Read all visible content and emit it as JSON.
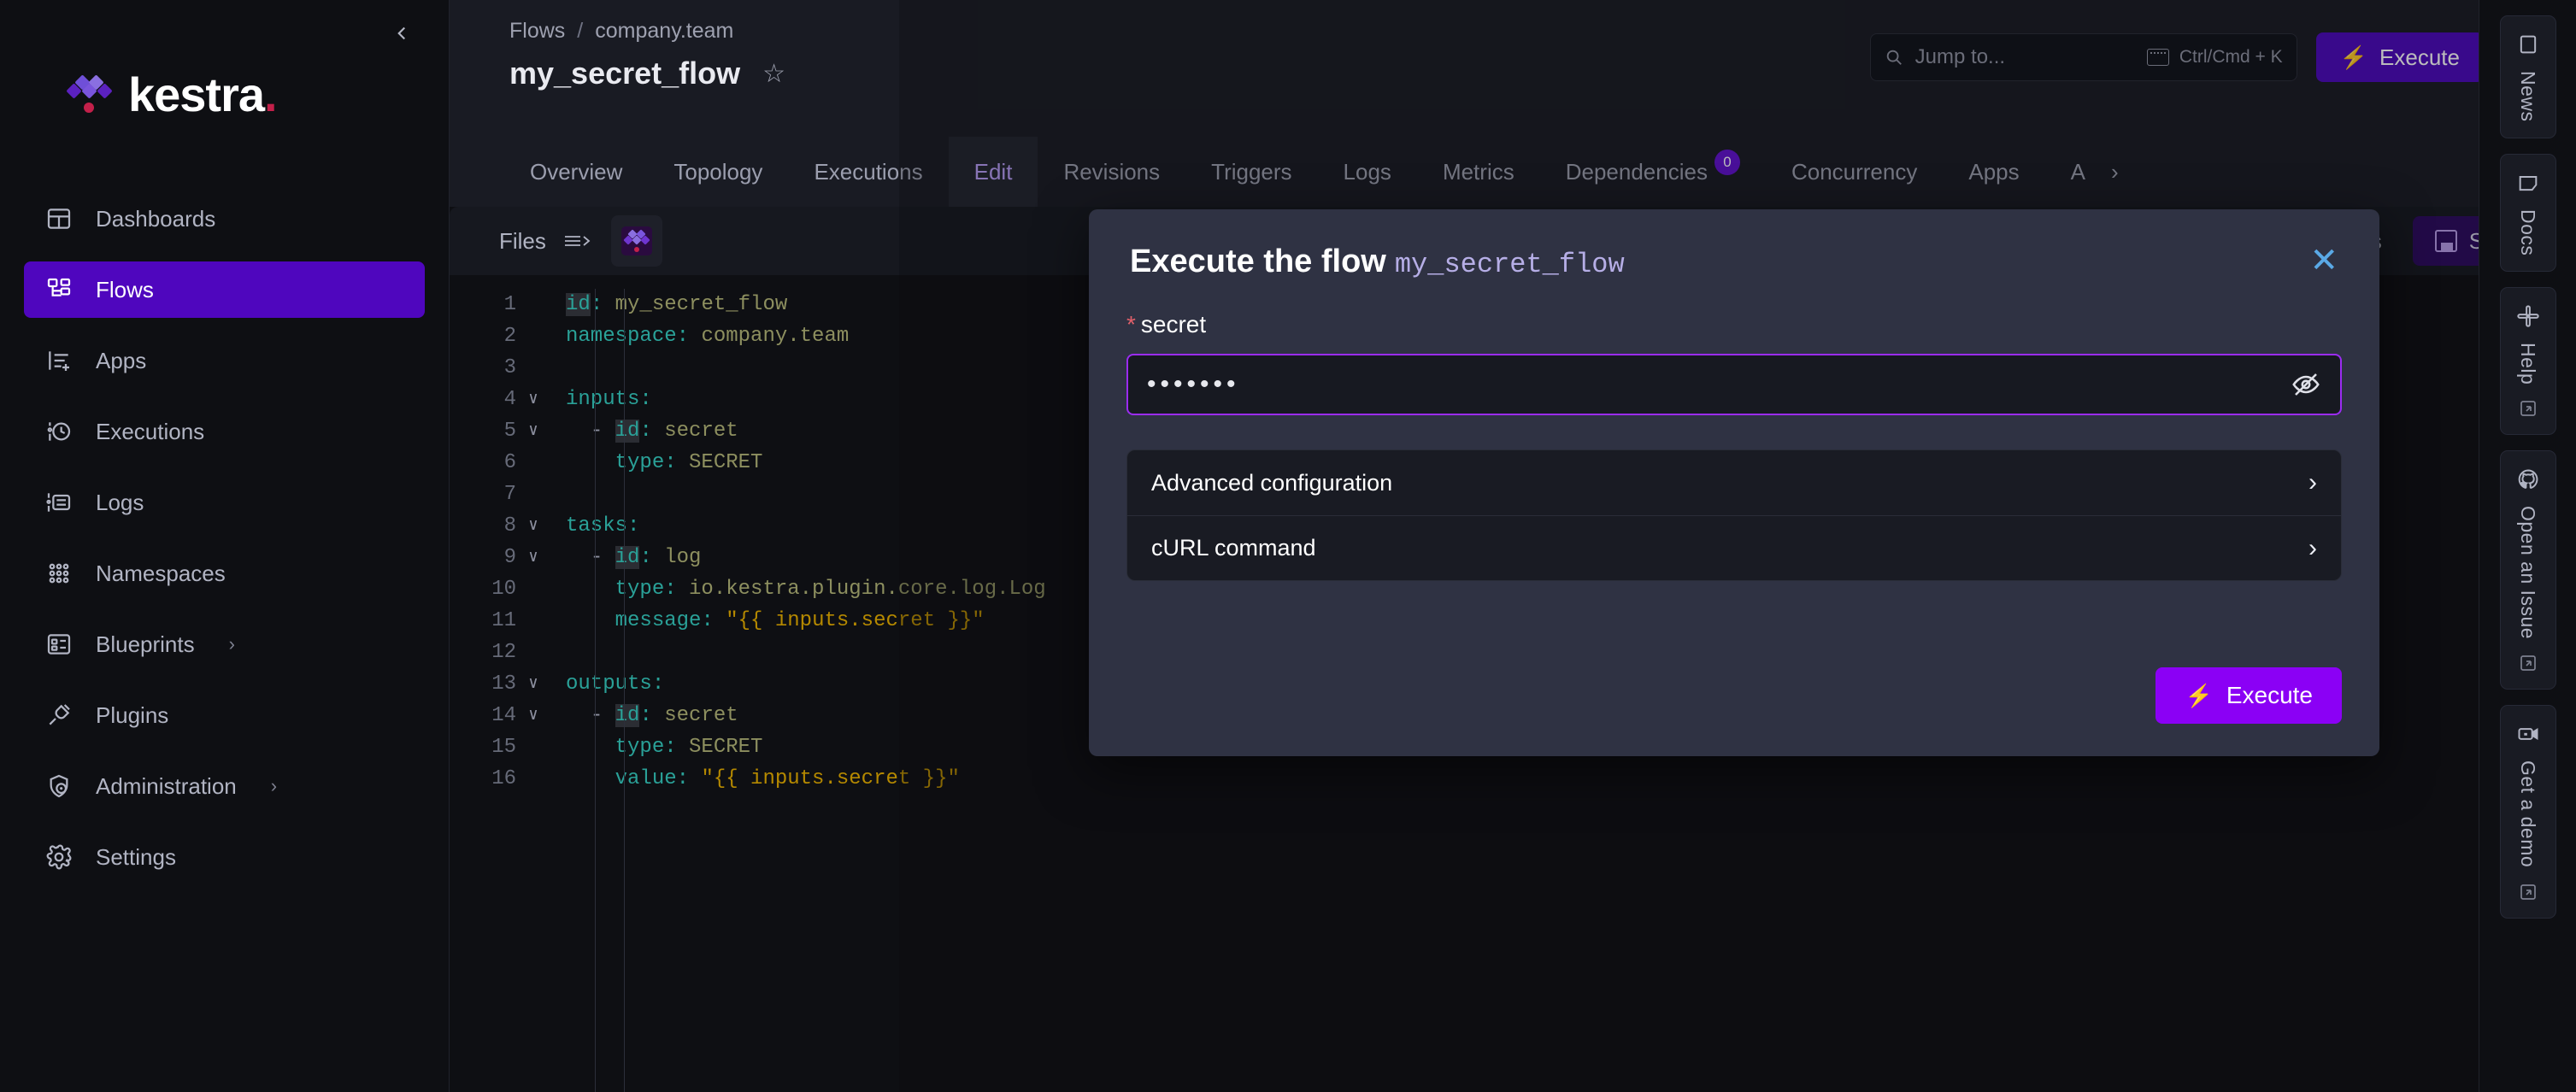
{
  "sidebar": {
    "logo_text": "kestra",
    "logo_dot": ".",
    "collapse_icon": "chevron-left",
    "items": [
      {
        "label": "Dashboards",
        "icon": "dashboard-icon",
        "active": false,
        "chevron": ""
      },
      {
        "label": "Flows",
        "icon": "flows-icon",
        "active": true,
        "chevron": ""
      },
      {
        "label": "Apps",
        "icon": "apps-icon",
        "active": false,
        "chevron": ""
      },
      {
        "label": "Executions",
        "icon": "executions-icon",
        "active": false,
        "chevron": ""
      },
      {
        "label": "Logs",
        "icon": "logs-icon",
        "active": false,
        "chevron": ""
      },
      {
        "label": "Namespaces",
        "icon": "namespaces-icon",
        "active": false,
        "chevron": ""
      },
      {
        "label": "Blueprints",
        "icon": "blueprints-icon",
        "active": false,
        "chevron": "›"
      },
      {
        "label": "Plugins",
        "icon": "plugins-icon",
        "active": false,
        "chevron": ""
      },
      {
        "label": "Administration",
        "icon": "administration-icon",
        "active": false,
        "chevron": "›"
      },
      {
        "label": "Settings",
        "icon": "settings-icon",
        "active": false,
        "chevron": ""
      }
    ]
  },
  "header": {
    "breadcrumb_root": "Flows",
    "breadcrumb_sep": "/",
    "breadcrumb_namespace": "company.team",
    "page_title": "my_secret_flow",
    "star_glyph": "☆",
    "jump_placeholder": "Jump to...",
    "shortcut_hint": "Ctrl/Cmd + K",
    "execute_label": "Execute",
    "execute_bolt": "⚡"
  },
  "tabs": [
    {
      "label": "Overview",
      "active": false,
      "badge": ""
    },
    {
      "label": "Topology",
      "active": false,
      "badge": ""
    },
    {
      "label": "Executions",
      "active": false,
      "badge": ""
    },
    {
      "label": "Edit",
      "active": true,
      "badge": ""
    },
    {
      "label": "Revisions",
      "active": false,
      "badge": ""
    },
    {
      "label": "Triggers",
      "active": false,
      "badge": ""
    },
    {
      "label": "Logs",
      "active": false,
      "badge": ""
    },
    {
      "label": "Metrics",
      "active": false,
      "badge": ""
    },
    {
      "label": "Dependencies",
      "active": false,
      "badge": "0"
    },
    {
      "label": "Concurrency",
      "active": false,
      "badge": ""
    },
    {
      "label": "Apps",
      "active": false,
      "badge": ""
    },
    {
      "label": "A",
      "active": false,
      "badge": ""
    }
  ],
  "tabs_overflow_chevron": "›",
  "editor_toolbar": {
    "files_label": "Files",
    "actions_label": "Actions",
    "actions_dots": "⋮",
    "save_label": "Save"
  },
  "editor": {
    "lines": [
      {
        "n": 1,
        "fold": "",
        "html": "<span class=\"k-key-hl\">id</span><span class=\"k-key\">:</span> <span class=\"k-plain\">my_secret_flow</span>"
      },
      {
        "n": 2,
        "fold": "",
        "html": "<span class=\"k-key\">namespace</span><span class=\"k-key\">:</span> <span class=\"k-plain\">company.team</span>"
      },
      {
        "n": 3,
        "fold": "",
        "html": ""
      },
      {
        "n": 4,
        "fold": "∨",
        "html": "<span class=\"k-key\">inputs</span><span class=\"k-key\">:</span>"
      },
      {
        "n": 5,
        "fold": "∨",
        "html": "  <span class=\"k-dash\">-</span> <span class=\"k-key-hl\">id</span><span class=\"k-key\">:</span> <span class=\"k-plain\">secret</span>"
      },
      {
        "n": 6,
        "fold": "",
        "html": "    <span class=\"k-key\">type</span><span class=\"k-key\">:</span> <span class=\"k-plain\">SECRET</span>"
      },
      {
        "n": 7,
        "fold": "",
        "html": ""
      },
      {
        "n": 8,
        "fold": "∨",
        "html": "<span class=\"k-key\">tasks</span><span class=\"k-key\">:</span>"
      },
      {
        "n": 9,
        "fold": "∨",
        "html": "  <span class=\"k-dash\">-</span> <span class=\"k-key-hl\">id</span><span class=\"k-key\">:</span> <span class=\"k-plain\">log</span>"
      },
      {
        "n": 10,
        "fold": "",
        "html": "    <span class=\"k-key\">type</span><span class=\"k-key\">:</span> <span class=\"k-plain\">io.kestra.plugin.core.log.Log</span>"
      },
      {
        "n": 11,
        "fold": "",
        "html": "    <span class=\"k-key\">message</span><span class=\"k-key\">:</span> <span class=\"k-str\">\"{{ inputs.secret }}\"</span>"
      },
      {
        "n": 12,
        "fold": "",
        "html": ""
      },
      {
        "n": 13,
        "fold": "∨",
        "html": "<span class=\"k-key\">outputs</span><span class=\"k-key\">:</span>"
      },
      {
        "n": 14,
        "fold": "∨",
        "html": "  <span class=\"k-dash\">-</span> <span class=\"k-key-hl\">id</span><span class=\"k-key\">:</span> <span class=\"k-plain\">secret</span>"
      },
      {
        "n": 15,
        "fold": "",
        "html": "    <span class=\"k-key\">type</span><span class=\"k-key\">:</span> <span class=\"k-plain\">SECRET</span>"
      },
      {
        "n": 16,
        "fold": "",
        "html": "    <span class=\"k-key\">value</span><span class=\"k-key\">:</span> <span class=\"k-str\">\"{{ inputs.secret }}\"</span>"
      }
    ]
  },
  "modal": {
    "title_prefix": "Execute the flow",
    "flow_name": "my_secret_flow",
    "close_glyph": "✕",
    "field_required_star": "*",
    "field_label": "secret",
    "field_value_masked": "•••••••",
    "eye_icon": "eye-off-icon",
    "sections": [
      {
        "label": "Advanced configuration",
        "chevron": "›"
      },
      {
        "label": "cURL command",
        "chevron": "›"
      }
    ],
    "execute_label": "Execute",
    "execute_bolt": "⚡"
  },
  "right_rail": [
    {
      "label": "News",
      "icon": "news-icon",
      "external": false
    },
    {
      "label": "Docs",
      "icon": "docs-icon",
      "external": false
    },
    {
      "label": "Help",
      "icon": "slack-icon",
      "external": true
    },
    {
      "label": "Open an Issue",
      "icon": "github-icon",
      "external": true
    },
    {
      "label": "Get a demo",
      "icon": "demo-icon",
      "external": true
    }
  ],
  "colors": {
    "accent_purple": "#4b09bb",
    "modal_execute_purple": "#8b00f5",
    "input_focus_border": "#9b2cf2",
    "badge_purple": "#6211cf",
    "sidebar_active": "#4f06be",
    "close_blue": "#5aa9e6",
    "required_red": "#e0606a",
    "valid_green": "#179a7b",
    "logo_dot_red": "#c3204a"
  }
}
